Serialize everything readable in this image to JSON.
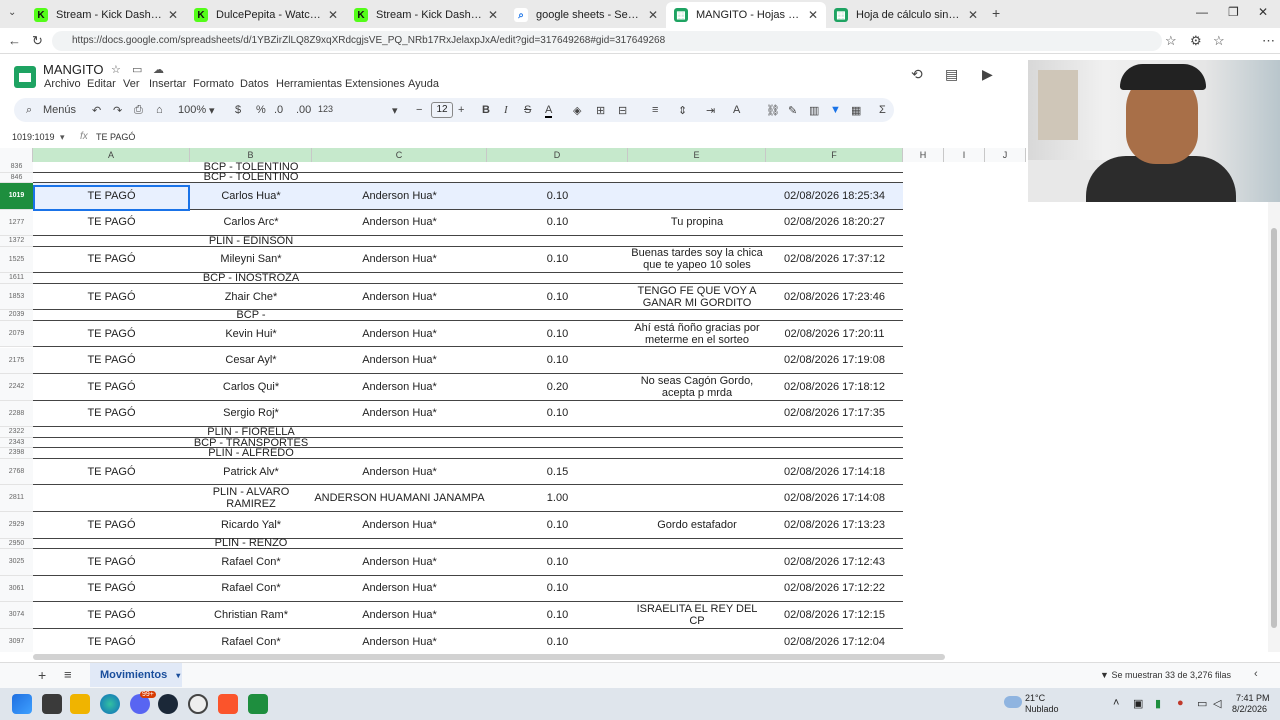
{
  "browser": {
    "tabs": [
      {
        "title": "Stream - Kick Dashboard",
        "color": "#53fc18",
        "glyph": "K"
      },
      {
        "title": "DulcePepita - Watch clips on Kick",
        "color": "#53fc18",
        "glyph": "K"
      },
      {
        "title": "Stream - Kick Dashboard",
        "color": "#53fc18",
        "glyph": "K"
      },
      {
        "title": "google sheets - Search",
        "color": "#1a73e8",
        "glyph": "⌕"
      },
      {
        "title": "MANGITO - Hojas de cálculo de G",
        "color": "#1ea362",
        "glyph": "▦"
      },
      {
        "title": "Hoja de cálculo sin título - Hojas c",
        "color": "#1ea362",
        "glyph": "▦"
      }
    ],
    "url": "https://docs.google.com/spreadsheets/d/1YBZirZlLQ8Z9xqXRdcgjsVE_PQ_NRb17RxJelaxpJxA/edit?gid=317649268#gid=317649268"
  },
  "doc": {
    "title": "MANGITO",
    "menus": [
      "Archivo",
      "Editar",
      "Ver",
      "Insertar",
      "Formato",
      "Datos",
      "Herramientas",
      "Extensiones",
      "Ayuda"
    ]
  },
  "toolbar": {
    "search_label": "Menús",
    "zoom": "100%",
    "currency": "$",
    "percent": "%",
    "dec_less": ".0",
    "dec_more": ".00",
    "number_format": "123",
    "font_size": "12"
  },
  "formula_bar": {
    "name_box": "1019:1019",
    "fx": "fx",
    "content": "TE PAGÓ"
  },
  "columns": [
    "A",
    "B",
    "C",
    "D",
    "E",
    "F",
    "H",
    "I",
    "J"
  ],
  "rows": [
    {
      "num": "836",
      "kind": "thin",
      "b": "BCP - TOLENTINO"
    },
    {
      "num": "846",
      "kind": "thin",
      "b": "BCP - TOLENTINO"
    },
    {
      "num": "1019",
      "kind": "full",
      "selected": true,
      "a": "TE PAGÓ",
      "b": "Carlos Hua*",
      "c": "Anderson Hua*",
      "d": "0.10",
      "e": "",
      "f": "02/08/2026 18:25:34"
    },
    {
      "num": "1277",
      "kind": "full",
      "a": "TE PAGÓ",
      "b": "Carlos Arc*",
      "c": "Anderson Hua*",
      "d": "0.10",
      "e": "Tu propina",
      "f": "02/08/2026 18:20:27"
    },
    {
      "num": "1372",
      "kind": "thin",
      "b": "PLIN - EDINSON"
    },
    {
      "num": "1525",
      "kind": "full",
      "a": "TE PAGÓ",
      "b": "Mileyni San*",
      "c": "Anderson Hua*",
      "d": "0.10",
      "e": "Buenas tardes soy la chica que te yapeo 10 soles",
      "f": "02/08/2026 17:37:12"
    },
    {
      "num": "1611",
      "kind": "thin",
      "b": "BCP - INOSTROZA"
    },
    {
      "num": "1853",
      "kind": "full",
      "a": "TE PAGÓ",
      "b": "Zhair Che*",
      "c": "Anderson Hua*",
      "d": "0.10",
      "e": "TENGO FE QUE VOY A GANAR MI GORDITO",
      "f": "02/08/2026 17:23:46"
    },
    {
      "num": "2039",
      "kind": "thin",
      "b": "BCP -"
    },
    {
      "num": "2079",
      "kind": "full",
      "a": "TE PAGÓ",
      "b": "Kevin Hui*",
      "c": "Anderson Hua*",
      "d": "0.10",
      "e": "Ahí está ñoño gracias por meterme en el sorteo",
      "f": "02/08/2026 17:20:11"
    },
    {
      "num": "2175",
      "kind": "full",
      "a": "TE PAGÓ",
      "b": "Cesar Ayl*",
      "c": "Anderson Hua*",
      "d": "0.10",
      "e": "",
      "f": "02/08/2026 17:19:08"
    },
    {
      "num": "2242",
      "kind": "full",
      "a": "TE PAGÓ",
      "b": "Carlos Qui*",
      "c": "Anderson Hua*",
      "d": "0.20",
      "e": "No seas Cagón Gordo, acepta p mrda",
      "f": "02/08/2026 17:18:12"
    },
    {
      "num": "2288",
      "kind": "full",
      "a": "TE PAGÓ",
      "b": "Sergio Roj*",
      "c": "Anderson Hua*",
      "d": "0.10",
      "e": "",
      "f": "02/08/2026 17:17:35"
    },
    {
      "num": "2322",
      "kind": "thin",
      "b": "PLIN - FIORELLA"
    },
    {
      "num": "2343",
      "kind": "thin",
      "b": "BCP - TRANSPORTES"
    },
    {
      "num": "2398",
      "kind": "thin",
      "b": "PLIN - ALFREDO"
    },
    {
      "num": "2768",
      "kind": "full",
      "a": "TE PAGÓ",
      "b": "Patrick Alv*",
      "c": "Anderson Hua*",
      "d": "0.15",
      "e": "",
      "f": "02/08/2026 17:14:18"
    },
    {
      "num": "2811",
      "kind": "full",
      "a": "",
      "b": "PLIN - ALVARO RAMIREZ",
      "c": "ANDERSON HUAMANI JANAMPA",
      "d": "1.00",
      "e": "",
      "f": "02/08/2026 17:14:08"
    },
    {
      "num": "2929",
      "kind": "full",
      "a": "TE PAGÓ",
      "b": "Ricardo Yal*",
      "c": "Anderson Hua*",
      "d": "0.10",
      "e": "Gordo estafador",
      "f": "02/08/2026 17:13:23"
    },
    {
      "num": "2950",
      "kind": "thin",
      "b": "PLIN - RENZO"
    },
    {
      "num": "3025",
      "kind": "full",
      "a": "TE PAGÓ",
      "b": "Rafael Con*",
      "c": "Anderson Hua*",
      "d": "0.10",
      "e": "",
      "f": "02/08/2026 17:12:43"
    },
    {
      "num": "3061",
      "kind": "full",
      "a": "TE PAGÓ",
      "b": "Rafael Con*",
      "c": "Anderson Hua*",
      "d": "0.10",
      "e": "",
      "f": "02/08/2026 17:12:22"
    },
    {
      "num": "3074",
      "kind": "full",
      "a": "TE PAGÓ",
      "b": "Christian Ram*",
      "c": "Anderson Hua*",
      "d": "0.10",
      "e": "ISRAELITA EL REY DEL CP",
      "f": "02/08/2026 17:12:15"
    },
    {
      "num": "3097",
      "kind": "full",
      "a": "TE PAGÓ",
      "b": "Rafael Con*",
      "c": "Anderson Hua*",
      "d": "0.10",
      "e": "",
      "f": "02/08/2026 17:12:04"
    }
  ],
  "sheet": {
    "tab_name": "Movimientos",
    "filter_info": "Se muestran 33 de 3,276 filas"
  },
  "taskbar": {
    "weather_temp": "21°C",
    "weather_desc": "Nublado",
    "time": "7:41 PM",
    "date": "8/2/2026",
    "badge_count": "99+"
  },
  "colors": {
    "sheets_green": "#1ea362",
    "header_green": "#c6e9cc",
    "selection_blue": "#1a73e8",
    "kick_green": "#53fc18"
  }
}
